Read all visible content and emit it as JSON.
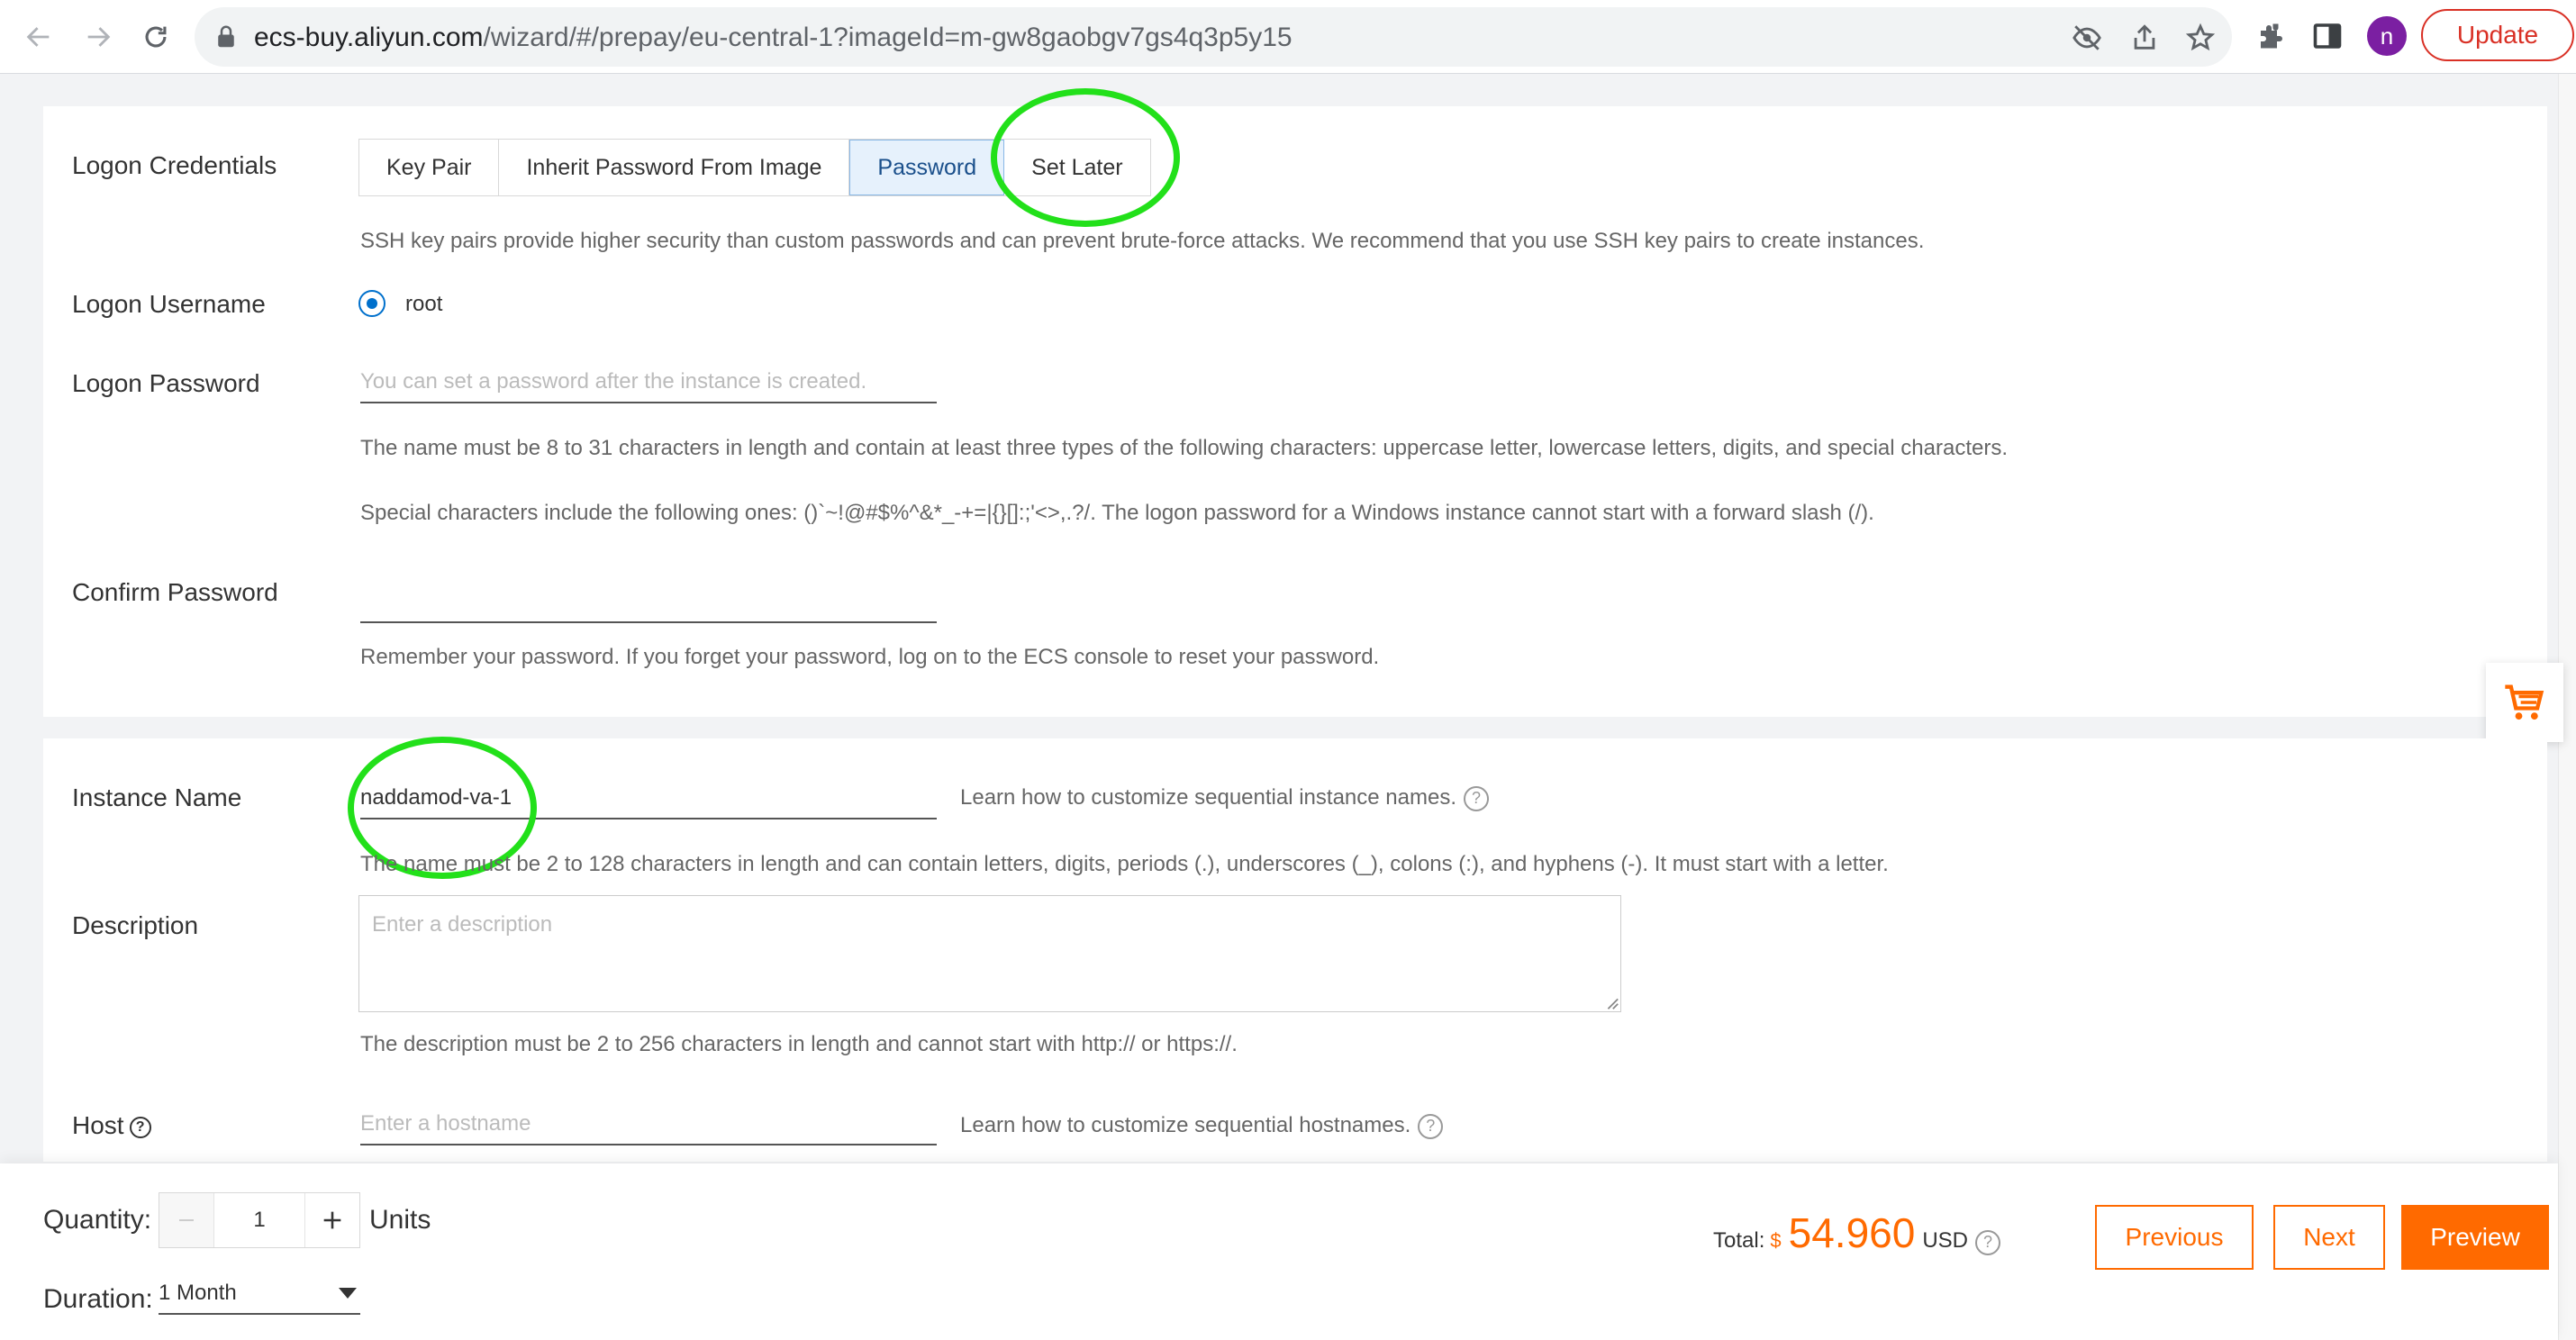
{
  "browser": {
    "url_host": "ecs-buy.aliyun.com",
    "url_path": "/wizard/#/prepay/eu-central-1?imageId=m-gw8gaobgv7gs4q3p5y15",
    "profile_initial": "n",
    "update_label": "Update"
  },
  "logon": {
    "credentials_label": "Logon Credentials",
    "tabs": [
      "Key Pair",
      "Inherit Password From Image",
      "Password",
      "Set Later"
    ],
    "active_tab": "Password",
    "ssh_hint": "SSH key pairs provide higher security than custom passwords and can prevent brute-force attacks. We recommend that you use SSH key pairs to create instances.",
    "username_label": "Logon Username",
    "username_value": "root",
    "password_label": "Logon Password",
    "password_placeholder": "You can set a password after the instance is created.",
    "password_rule": "The name must be 8 to 31 characters in length and contain at least three types of the following characters: uppercase letter, lowercase letters, digits, and special characters.",
    "special_chars_rule": "Special characters include the following ones: ()`~!@#$%^&*_-+=|{}[]:;'<>,.?/. The logon password for a Windows instance cannot start with a forward slash (/).",
    "confirm_label": "Confirm Password",
    "confirm_hint": "Remember your password. If you forget your password, log on to the ECS console to reset your password."
  },
  "instance": {
    "name_label": "Instance Name",
    "name_value": "naddamod-va-1",
    "name_learn": "Learn how to customize sequential instance names.",
    "name_rule": "The name must be 2 to 128 characters in length and can contain letters, digits, periods (.), underscores (_), colons (:), and hyphens (-). It must start with a letter.",
    "description_label": "Description",
    "description_placeholder": "Enter a description",
    "description_rule": "The description must be 2 to 256 characters in length and cannot start with http:// or https://.",
    "host_label": "Host",
    "host_placeholder": "Enter a hostname",
    "host_learn": "Learn how to customize sequential hostnames.",
    "help_glyph": "?"
  },
  "footer": {
    "quantity_label": "Quantity:",
    "quantity_value": "1",
    "units_label": "Units",
    "duration_label": "Duration:",
    "duration_value": "1 Month",
    "total_label": "Total:",
    "currency_symbol": "$",
    "total_amount": "54.960",
    "currency": "USD",
    "previous_label": "Previous",
    "next_label": "Next",
    "preview_label": "Preview"
  },
  "colors": {
    "accent_orange": "#ff6a00",
    "annotation_green": "#22e01a",
    "selected_tab_bg": "#e6f1fc",
    "radio_blue": "#0070cc"
  },
  "icons": [
    "back-icon",
    "forward-icon",
    "reload-icon",
    "lock-icon",
    "eye-off-icon",
    "share-icon",
    "star-icon",
    "extensions-icon",
    "side-panel-icon",
    "cart-icon",
    "help-icon",
    "minus-icon",
    "plus-icon",
    "chevron-down-icon",
    "resize-grip-icon"
  ]
}
